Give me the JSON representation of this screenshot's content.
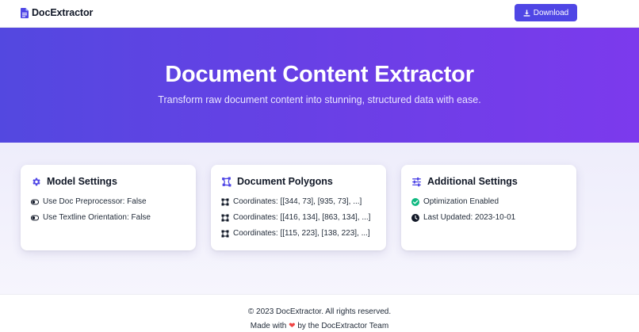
{
  "navbar": {
    "brand_name": "DocExtractor",
    "brand_icon": "document-icon",
    "download_label": "Download",
    "download_icon": "download-icon",
    "accent_color": "#4f46e5"
  },
  "hero": {
    "title": "Document Content Extractor",
    "subtitle": "Transform raw document content into stunning, structured data with ease.",
    "gradient_start": "#5348e0",
    "gradient_end": "#7c3aed"
  },
  "cards": [
    {
      "title": "Model Settings",
      "icon": "gear-icon",
      "rows": [
        {
          "icon": "toggle-icon",
          "text": "Use Doc Preprocessor: False"
        },
        {
          "icon": "toggle-icon",
          "text": "Use Textline Orientation: False"
        }
      ]
    },
    {
      "title": "Document Polygons",
      "icon": "polygon-icon",
      "rows": [
        {
          "icon": "vector-square-icon",
          "text": "Coordinates: [[344, 73], [935, 73], ...]"
        },
        {
          "icon": "vector-square-icon",
          "text": "Coordinates: [[416, 134], [863, 134], ...]"
        },
        {
          "icon": "vector-square-icon",
          "text": "Coordinates: [[115, 223], [138, 223], ...]"
        }
      ]
    },
    {
      "title": "Additional Settings",
      "icon": "sliders-icon",
      "rows": [
        {
          "icon": "check-circle-icon",
          "text": "Optimization Enabled",
          "color": "#10b981"
        },
        {
          "icon": "clock-icon",
          "text": "Last Updated: 2023-10-01"
        }
      ]
    }
  ],
  "footer": {
    "copyright": "© 2023 DocExtractor. All rights reserved.",
    "made_with_prefix": "Made with",
    "heart": "❤",
    "made_with_suffix": "by the DocExtractor Team",
    "heart_color": "#ef4444"
  }
}
